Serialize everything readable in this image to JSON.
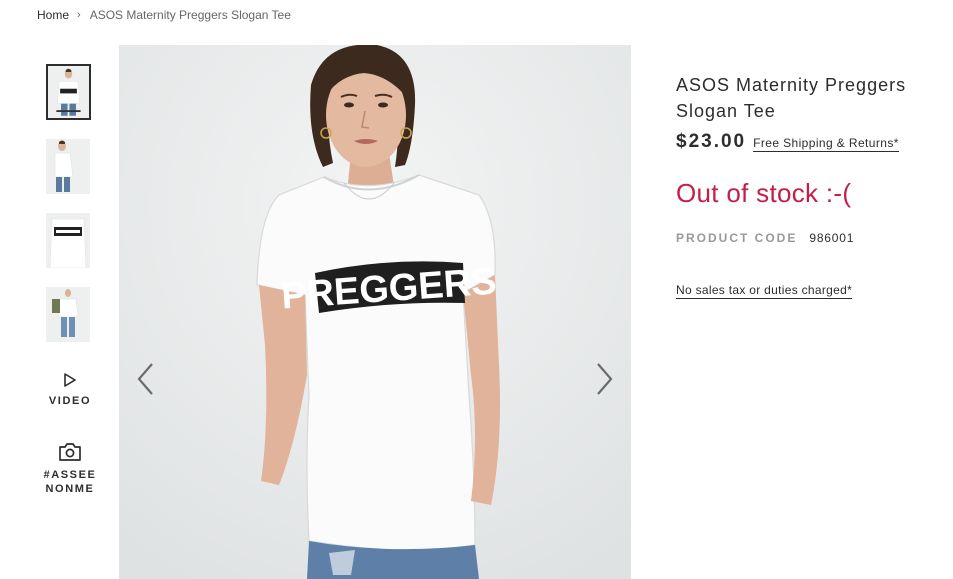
{
  "breadcrumb": {
    "home": "Home",
    "separator": "›",
    "current": "ASOS Maternity Preggers Slogan Tee"
  },
  "gallery": {
    "thumbnails": [
      {
        "name": "thumbnail-front",
        "active": true
      },
      {
        "name": "thumbnail-side",
        "active": false
      },
      {
        "name": "thumbnail-detail",
        "active": false
      },
      {
        "name": "thumbnail-full",
        "active": false
      }
    ],
    "video_label": "VIDEO",
    "asseenonme_label": "#ASSEENONME",
    "main_image_text": "PREGGERS",
    "prev_icon": "chevron-left-icon",
    "next_icon": "chevron-right-icon"
  },
  "product": {
    "title": "ASOS Maternity Preggers Slogan Tee",
    "price": "$23.00",
    "shipping_link": "Free Shipping & Returns*",
    "stock_status": "Out of stock :-(",
    "code_label": "PRODUCT CODE",
    "code_value": "986001",
    "tax_link": "No sales tax or duties charged*"
  },
  "colors": {
    "text": "#2d2d2d",
    "muted": "#999999",
    "out_of_stock": "#c41e4a",
    "image_bg": "#e8eaeb"
  }
}
